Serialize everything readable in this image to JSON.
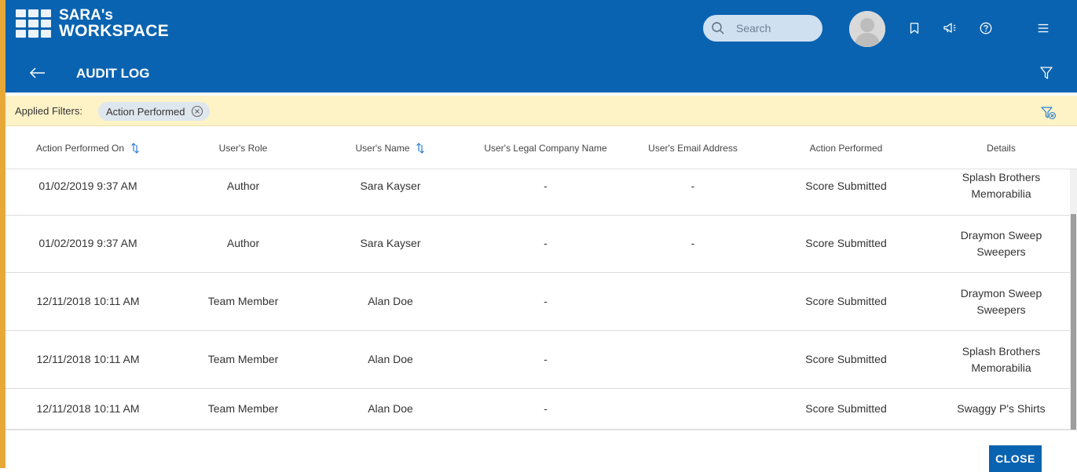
{
  "app": {
    "logo_line1": "SARA's",
    "logo_line2": "WORKSPACE"
  },
  "header": {
    "search_placeholder": "Search",
    "icons": [
      "search-icon",
      "avatar",
      "bookmark-icon",
      "megaphone-icon",
      "help-icon",
      "menu-icon"
    ]
  },
  "subbar": {
    "title": "AUDIT LOG",
    "icons": [
      "back-arrow-icon",
      "filter-icon"
    ]
  },
  "filters": {
    "label": "Applied Filters:",
    "chips": [
      {
        "label": "Action Performed"
      }
    ],
    "icons": [
      "remove-chip-icon",
      "clear-filters-icon"
    ]
  },
  "table": {
    "columns": [
      {
        "label": "Action Performed On",
        "sortable": true
      },
      {
        "label": "User's Role",
        "sortable": false
      },
      {
        "label": "User's Name",
        "sortable": true
      },
      {
        "label": "User's Legal Company Name",
        "sortable": false
      },
      {
        "label": "User's Email Address",
        "sortable": false
      },
      {
        "label": "Action Performed",
        "sortable": false
      },
      {
        "label": "Details",
        "sortable": false
      }
    ],
    "rows": [
      {
        "date": "01/02/2019 9:37 AM",
        "role": "Author",
        "name": "Sara Kayser",
        "company": "-",
        "email": "-",
        "action": "Score Submitted",
        "details": "Splash Brothers Memorabilia"
      },
      {
        "date": "01/02/2019 9:37 AM",
        "role": "Author",
        "name": "Sara Kayser",
        "company": "-",
        "email": "-",
        "action": "Score Submitted",
        "details": "Draymon Sweep Sweepers"
      },
      {
        "date": "12/11/2018 10:11 AM",
        "role": "Team Member",
        "name": "Alan Doe",
        "company": "-",
        "email": "",
        "action": "Score Submitted",
        "details": "Draymon Sweep Sweepers"
      },
      {
        "date": "12/11/2018 10:11 AM",
        "role": "Team Member",
        "name": "Alan Doe",
        "company": "-",
        "email": "",
        "action": "Score Submitted",
        "details": "Splash Brothers Memorabilia"
      },
      {
        "date": "12/11/2018 10:11 AM",
        "role": "Team Member",
        "name": "Alan Doe",
        "company": "-",
        "email": "",
        "action": "Score Submitted",
        "details": "Swaggy P's Shirts"
      }
    ]
  },
  "footer": {
    "close_label": "CLOSE"
  },
  "colors": {
    "header_bg": "#0a63b0",
    "filter_bar_bg": "#fdf3c7",
    "sort_icon": "#2a7fd4",
    "frame_accent": "#e8a838"
  }
}
